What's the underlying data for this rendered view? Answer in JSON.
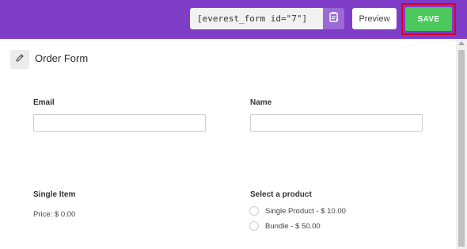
{
  "toolbar": {
    "shortcode": "[everest_form id=\"7\"]",
    "copy_icon": "clipboard-icon",
    "preview_label": "Preview",
    "save_label": "SAVE",
    "colors": {
      "bar": "#7f3cc7",
      "save": "#4bc95c",
      "highlight": "#e3001b"
    }
  },
  "form": {
    "edit_icon": "pencil-icon",
    "title": "Order Form",
    "fields": {
      "email": {
        "label": "Email",
        "value": ""
      },
      "name": {
        "label": "Name",
        "value": ""
      },
      "single_item": {
        "label": "Single Item",
        "price": "Price: $ 0.00"
      },
      "select_product": {
        "label": "Select a product",
        "options": [
          {
            "label": "Single Product - $ 10.00",
            "checked": false
          },
          {
            "label": "Bundle - $ 50.00",
            "checked": false
          }
        ]
      }
    }
  }
}
